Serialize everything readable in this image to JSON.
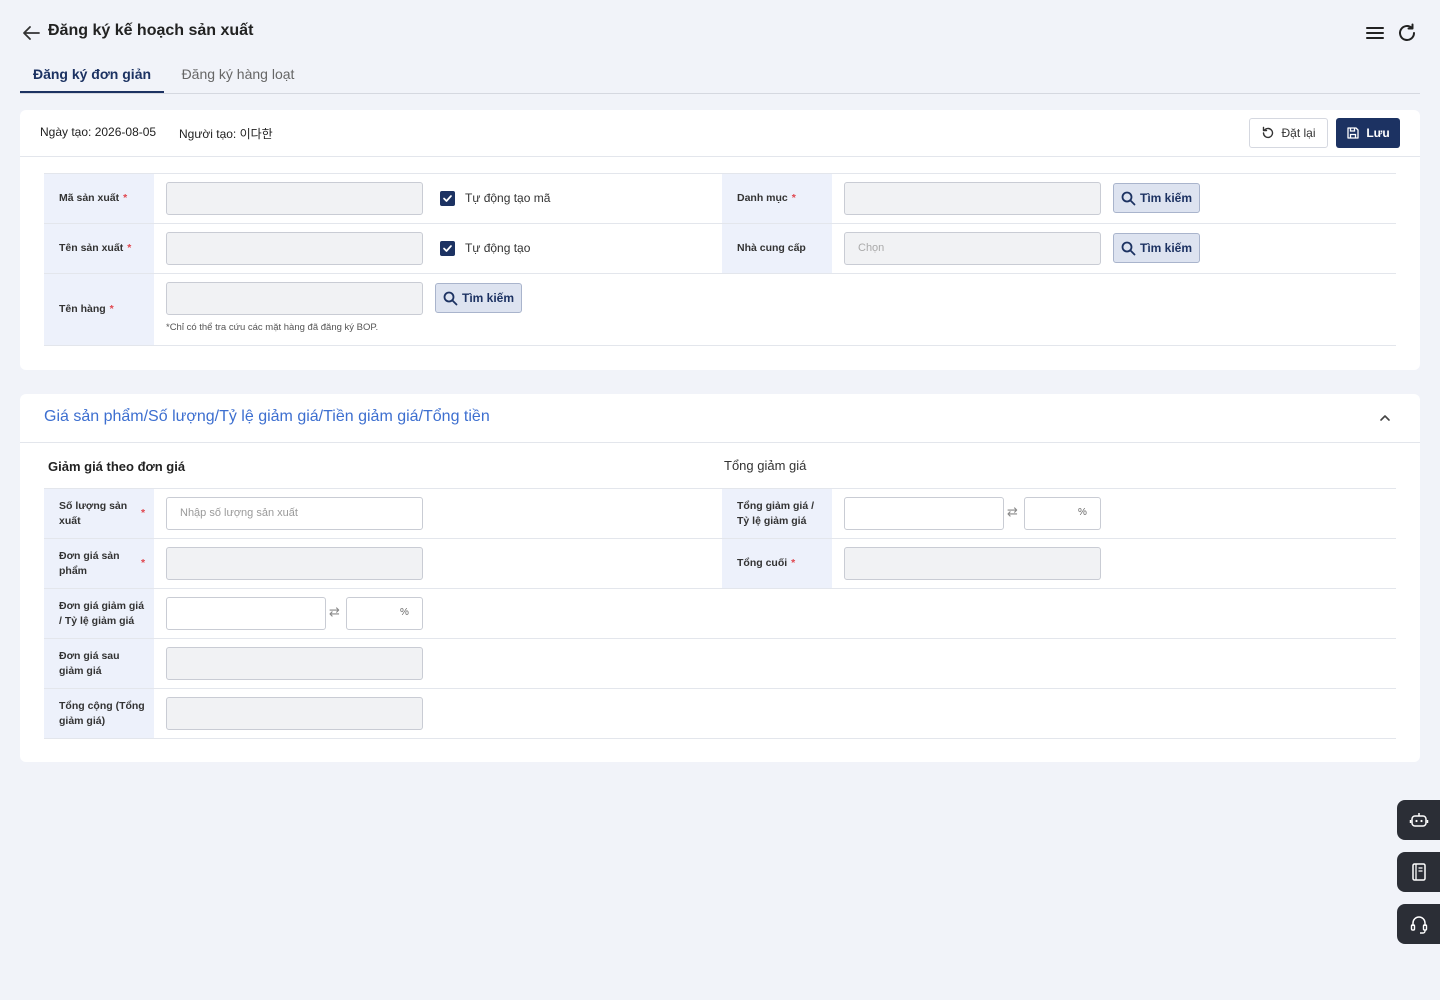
{
  "header": {
    "title": "Đăng ký kế hoạch sản xuất"
  },
  "tabs": [
    {
      "label": "Đăng ký đơn giản"
    },
    {
      "label": "Đăng ký hàng loạt"
    }
  ],
  "meta": {
    "created_date": "Ngày tạo: 2026-08-05",
    "created_by": "Người tạo: 이다한"
  },
  "toolbar": {
    "reset_label": "Đặt lại",
    "save_label": "Lưu"
  },
  "form": {
    "production_code_label": "Mã sản xuất",
    "auto_code_label": "Tự động tạo mã",
    "category_label": "Danh mục",
    "production_name_label": "Tên sản xuất",
    "auto_create_label": "Tự động tạo",
    "supplier_label": "Nhà cung cấp",
    "supplier_placeholder": "Chọn",
    "item_name_label": "Tên hàng",
    "item_note": "*Chỉ có thể tra cứu các mặt hàng đã đăng ký BOP.",
    "search_label": "Tìm kiếm",
    "required_mark": "*"
  },
  "pricing": {
    "section_title": "Giá sản phẩm/Số lượng/Tỷ lệ giảm giá/Tiền giảm giá/Tổng tiền",
    "unit_discount_title": "Giảm giá theo đơn giá",
    "total_discount_title": "Tổng giảm giá",
    "quantity_label": "Số lượng sản xuất",
    "quantity_placeholder": "Nhập số lượng sản xuất",
    "unit_price_label": "Đơn giá sản phẩm",
    "unit_discount_label": "Đơn giá giảm giá / Tỷ lệ giảm giá",
    "price_after_label": "Đơn giá sau giảm giá",
    "subtotal_label": "Tổng cộng (Tổng giảm giá)",
    "total_discount_label": "Tổng giảm giá / Tỷ lệ giảm giá",
    "final_total_label": "Tổng cuối",
    "percent": "%",
    "swap": "⇄"
  }
}
